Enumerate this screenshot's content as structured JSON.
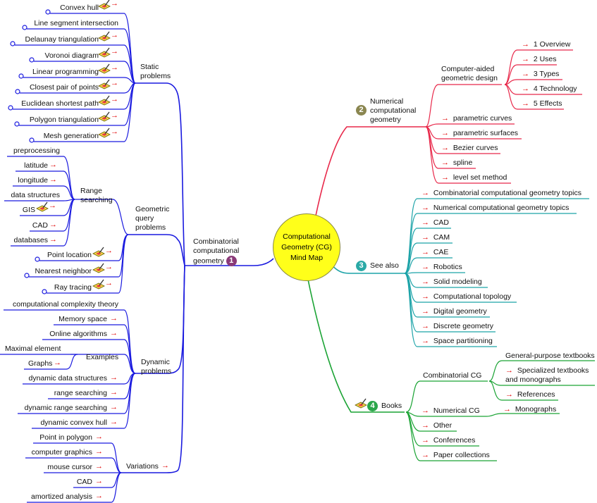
{
  "center": {
    "line1": "Computational",
    "line2": "Geometry (CG)",
    "line3": "Mind Map"
  },
  "colors": {
    "branch1": "#1a1adf",
    "branch2": "#e8284a",
    "branch3": "#1ca3a8",
    "branch4": "#1aa334",
    "center_fill": "#ffff1a",
    "arrow": "#e00000"
  },
  "icons": {
    "arrow": "→",
    "note": "pencil-note-icon"
  },
  "branch1": {
    "title": [
      "Combinatorial",
      "computational",
      "geometry"
    ],
    "badge": "1",
    "static": {
      "title": [
        "Static",
        "problems"
      ],
      "items": [
        "Convex hull",
        "Line segment intersection",
        "Delaunay triangulation",
        "Voronoi diagram",
        "Linear programming",
        "Closest pair of points",
        "Euclidean shortest path",
        "Polygon triangulation",
        "Mesh generation"
      ]
    },
    "query": {
      "title": [
        "Geometric",
        "query",
        "problems"
      ],
      "range": {
        "title": [
          "Range",
          "searching"
        ],
        "items": [
          "preprocessing",
          "latitude",
          "longitude",
          "data structures",
          "GIS",
          "CAD",
          "databases"
        ]
      },
      "items": [
        "Point location",
        "Nearest neighbor",
        "Ray tracing"
      ]
    },
    "dynamic": {
      "title": [
        "Dynamic",
        "problems"
      ],
      "items": [
        "computational complexity theory",
        "Memory space",
        "Online algorithms"
      ],
      "examples": {
        "title": "Examples",
        "items": [
          "Maximal element",
          "Graphs"
        ]
      },
      "items2": [
        "dynamic data structures",
        "range searching",
        "dynamic range searching",
        "dynamic convex hull"
      ]
    },
    "variations": {
      "title": "Variations",
      "items": [
        "Point in polygon",
        "computer graphics",
        "mouse cursor",
        "CAD",
        "amortized analysis"
      ]
    }
  },
  "branch2": {
    "title": [
      "Numerical",
      "computational",
      "geometry"
    ],
    "badge": "2",
    "cagd": {
      "title": [
        "Computer-aided",
        "geometric design"
      ],
      "items": [
        "1 Overview",
        "2 Uses",
        "3 Types",
        "4 Technology",
        "5 Effects"
      ]
    },
    "items": [
      "parametric curves",
      "parametric surfaces",
      "Bezier curves",
      "spline",
      "level set method"
    ]
  },
  "branch3": {
    "title": "See also",
    "badge": "3",
    "items": [
      "Combinatorial computational geometry topics",
      "Numerical computational geometry topics",
      "CAD",
      "CAM",
      "CAE",
      "Robotics",
      "Solid modeling",
      "Computational topology",
      "Digital geometry",
      "Discrete geometry",
      "Space partitioning"
    ]
  },
  "branch4": {
    "title": "Books",
    "badge": "4",
    "combinatorial": {
      "title": "Combinatorial CG",
      "items": [
        "General-purpose textbooks",
        [
          "Specialized textbooks",
          "and monographs"
        ],
        "References"
      ]
    },
    "numerical": {
      "title": "Numerical CG",
      "items": [
        "Monographs"
      ]
    },
    "items": [
      "Other",
      "Conferences",
      "Paper collections"
    ]
  }
}
